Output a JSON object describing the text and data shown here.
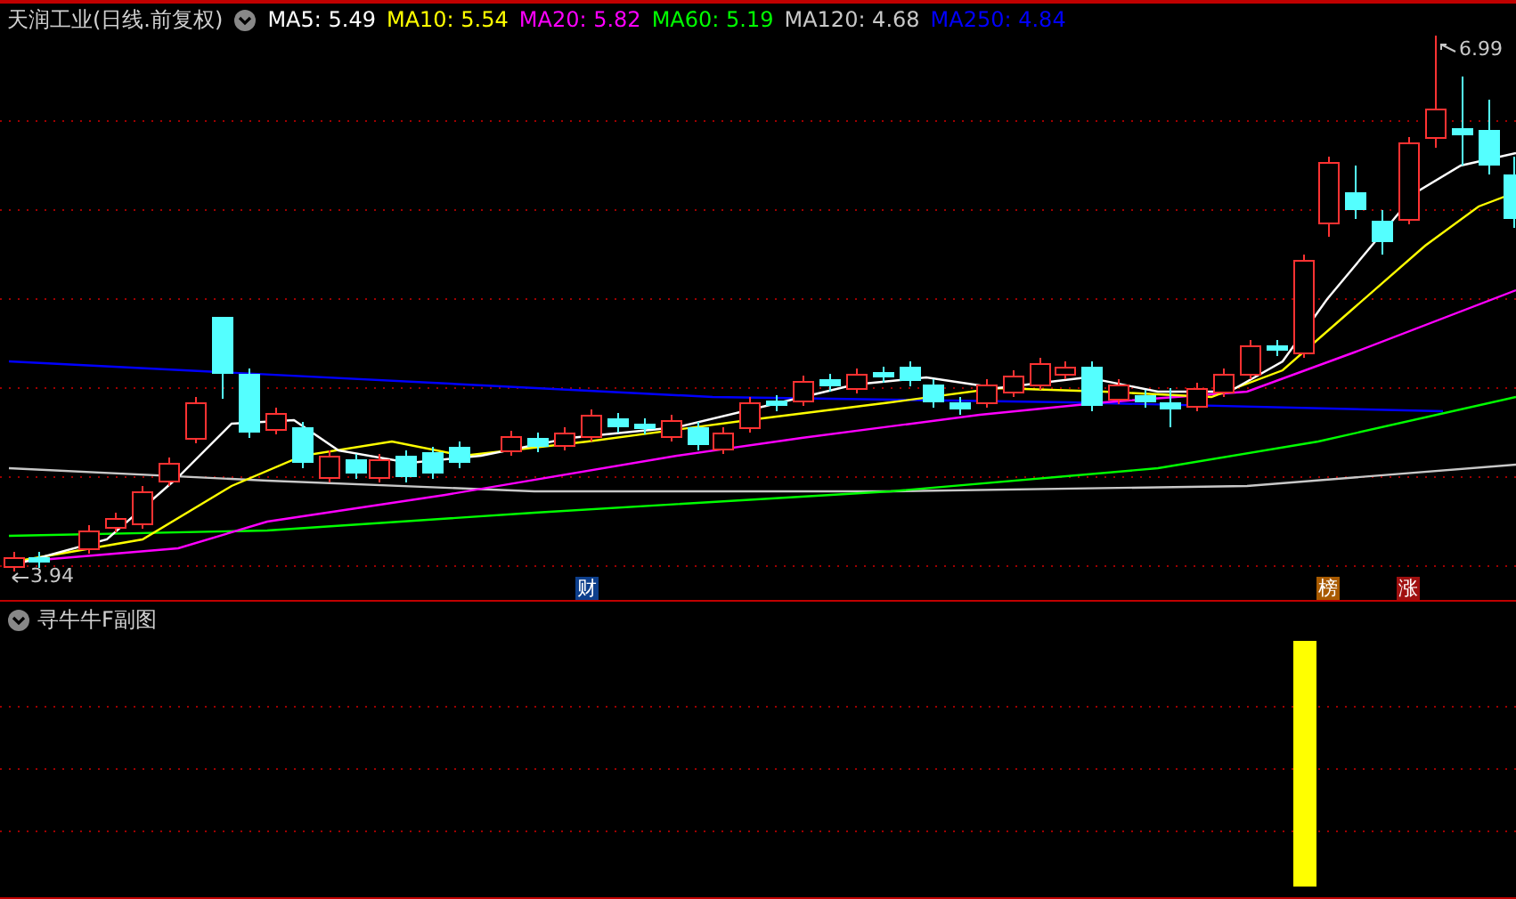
{
  "title": "天润工业(日线.前复权)",
  "ma": [
    {
      "label": "MA5: 5.49",
      "color": "#ffffff"
    },
    {
      "label": "MA10: 5.54",
      "color": "#ffff00"
    },
    {
      "label": "MA20: 5.82",
      "color": "#ff00ff"
    },
    {
      "label": "MA60: 5.19",
      "color": "#00ff00"
    },
    {
      "label": "MA120: 4.68",
      "color": "#c8c8c8"
    },
    {
      "label": "MA250: 4.84",
      "color": "#0000ff"
    }
  ],
  "price_markers": [
    {
      "label": "6.99",
      "kind": "high"
    },
    {
      "label": "3.94",
      "kind": "low"
    }
  ],
  "event_badges": [
    {
      "label": "财",
      "color": "#0d3f8c"
    },
    {
      "label": "榜",
      "color": "#a85a00"
    },
    {
      "label": "涨",
      "color": "#a01010"
    }
  ],
  "sub_chart": {
    "title": "寻牛牛F副图"
  }
}
